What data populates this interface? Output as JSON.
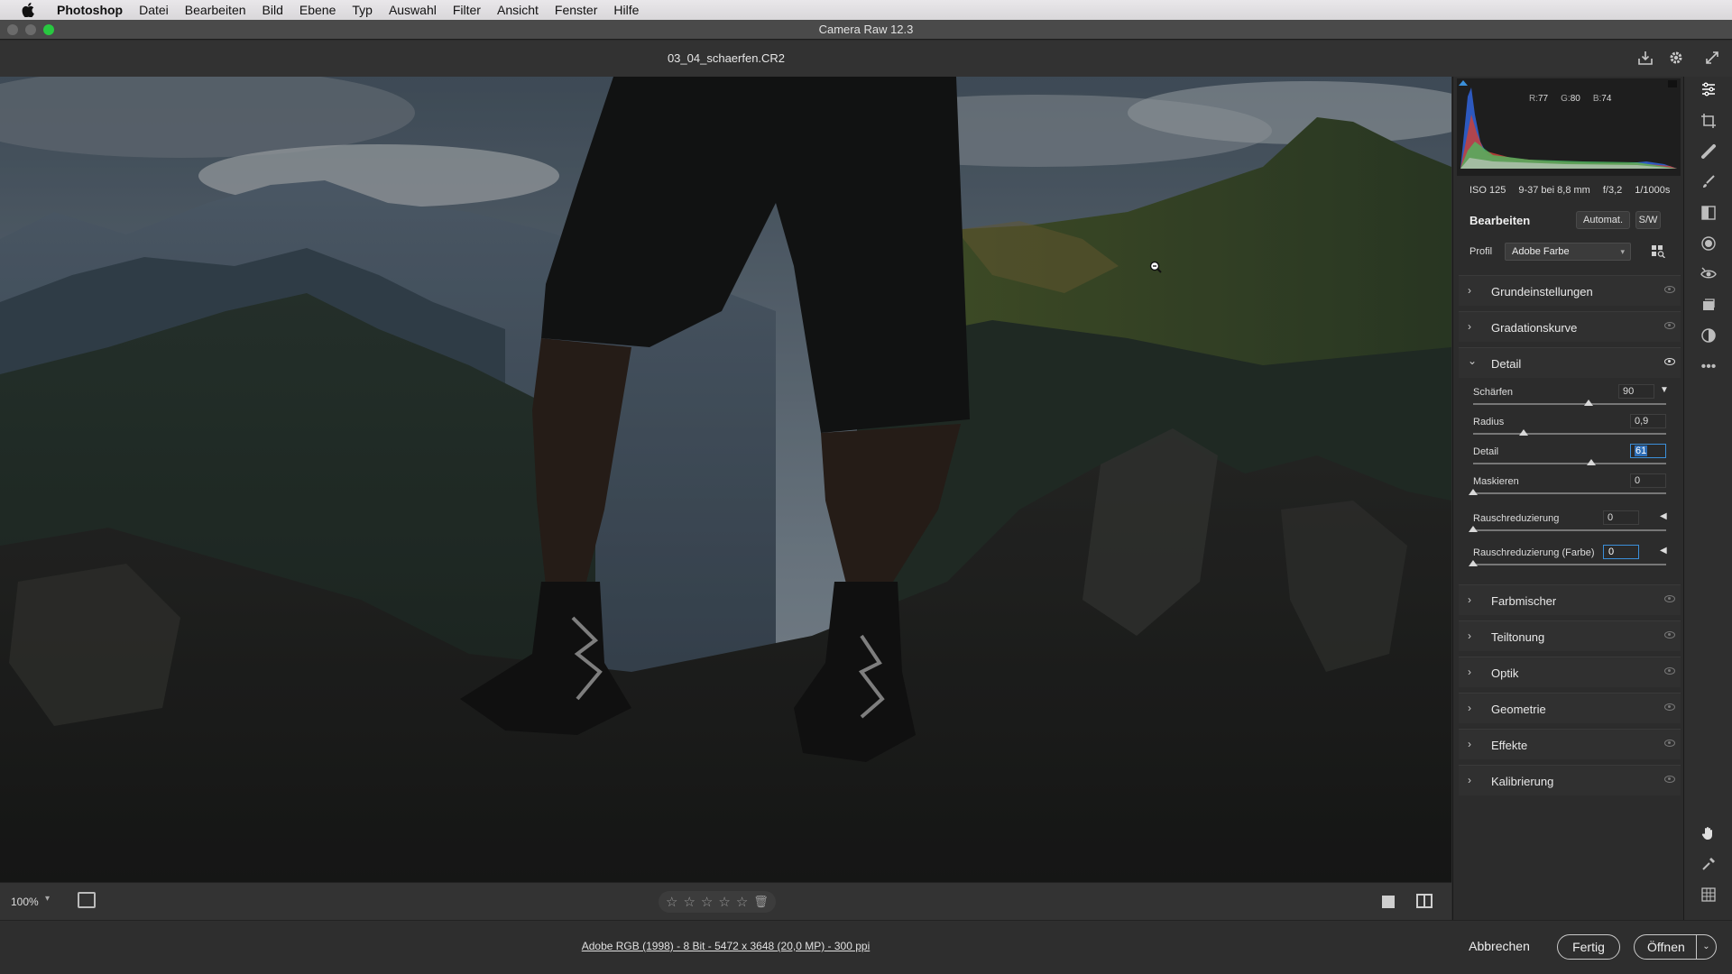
{
  "menubar": {
    "apple_icon": "apple-icon",
    "items": [
      "Photoshop",
      "Datei",
      "Bearbeiten",
      "Bild",
      "Ebene",
      "Typ",
      "Auswahl",
      "Filter",
      "Ansicht",
      "Fenster",
      "Hilfe"
    ]
  },
  "window": {
    "title": "Camera Raw 12.3"
  },
  "file": {
    "name": "03_04_schaerfen.CR2"
  },
  "header_icons": [
    "save-icon",
    "gear-icon",
    "fullscreen-icon"
  ],
  "histogram": {
    "r": "77",
    "g": "80",
    "b": "74",
    "r_label": "R:",
    "g_label": "G:",
    "b_label": "B:"
  },
  "camera": {
    "iso": "ISO 125",
    "lens": "9-37 bei 8,8 mm",
    "aperture": "f/3,2",
    "shutter": "1/1000s"
  },
  "edit": {
    "title": "Bearbeiten",
    "auto_label": "Automat.",
    "bw_label": "S/W"
  },
  "profile": {
    "label": "Profil",
    "value": "Adobe Farbe"
  },
  "sections_top": [
    {
      "title": "Grundeinstellungen"
    },
    {
      "title": "Gradationskurve"
    },
    {
      "title": "Detail"
    }
  ],
  "detail": {
    "sharpen_label": "Schärfen",
    "sharpen_value": "90",
    "sharpen_fraction": 0.6,
    "radius_label": "Radius",
    "radius_value": "0,9",
    "radius_fraction": 0.26,
    "detail_label": "Detail",
    "detail_value": "61",
    "detail_fraction": 0.61,
    "mask_label": "Maskieren",
    "mask_value": "0",
    "mask_fraction": 0,
    "nr_label": "Rauschreduzierung",
    "nr_value": "0",
    "nr_fraction": 0,
    "nrc_label": "Rauschreduzierung (Farbe)",
    "nrc_value": "0",
    "nrc_fraction": 0
  },
  "sections_bottom": [
    {
      "title": "Farbmischer"
    },
    {
      "title": "Teiltonung"
    },
    {
      "title": "Optik"
    },
    {
      "title": "Geometrie"
    },
    {
      "title": "Effekte"
    },
    {
      "title": "Kalibrierung"
    }
  ],
  "bottombar": {
    "zoom": "100%"
  },
  "footer": {
    "info": "Adobe RGB (1998) - 8 Bit - 5472 x 3648 (20,0 MP) - 300 ppi",
    "cancel": "Abbrechen",
    "done": "Fertig",
    "open": "Öffnen"
  },
  "toolbar_icons": [
    "edit-sliders-icon",
    "crop-icon",
    "healing-icon",
    "brush-icon",
    "gradient-icon",
    "radial-filter-icon",
    "red-eye-icon",
    "snapshots-icon",
    "presets-icon",
    "more-icon",
    "hand-icon",
    "color-sampler-icon",
    "grid-icon"
  ],
  "colors": {
    "accent": "#3b8fd9",
    "panel": "#2c2c2c",
    "green_button": "#28c840"
  }
}
